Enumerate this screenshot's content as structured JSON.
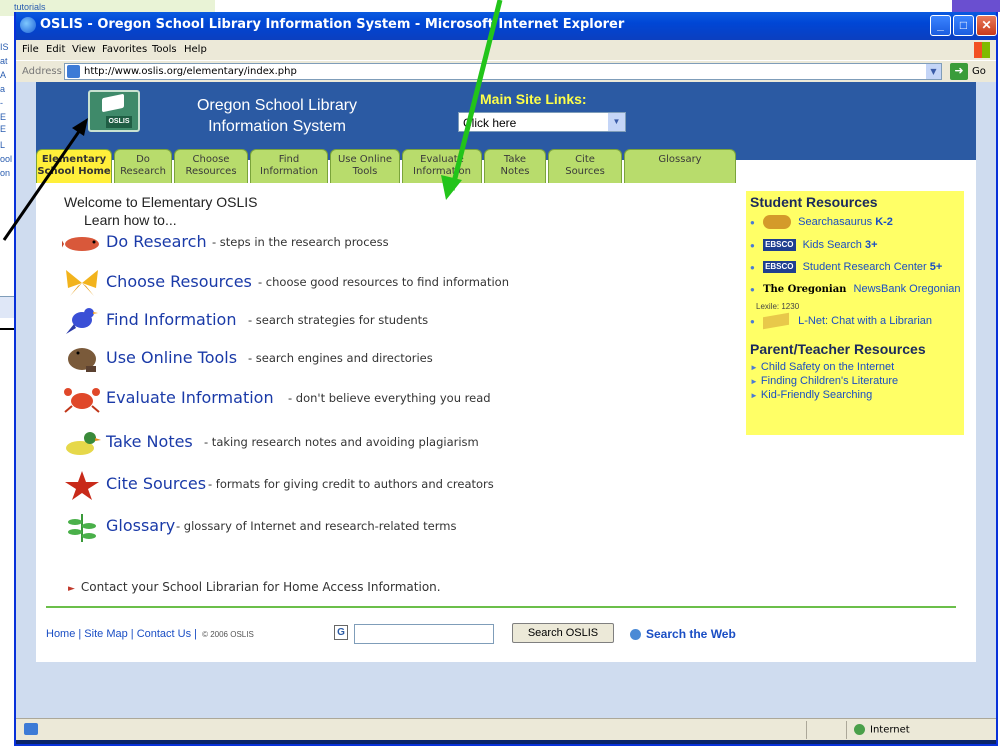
{
  "background_window": {
    "lines": [
      "tutorials",
      "IS",
      "at",
      "A",
      "a",
      "-",
      "E",
      "E",
      "L",
      "ool",
      "on"
    ]
  },
  "window": {
    "title": "OSLIS - Oregon School Library Information System - Microsoft Internet Explorer",
    "controls": {
      "minimize": "_",
      "maximize": "□",
      "close": "✕"
    }
  },
  "menu": {
    "items": [
      "File",
      "Edit",
      "View",
      "Favorites",
      "Tools",
      "Help"
    ]
  },
  "address": {
    "label": "Address",
    "url": "http://www.oslis.org/elementary/index.php",
    "go_label": "Go"
  },
  "header": {
    "logo_label": "OSLIS",
    "site_name_line1": "Oregon School Library",
    "site_name_line2": "Information System",
    "main_links_label": "Main Site Links:",
    "main_links_selected": "Click here"
  },
  "tabs": [
    {
      "line1": "Elementary",
      "line2": "School Home"
    },
    {
      "line1": "Do",
      "line2": "Research"
    },
    {
      "line1": "Choose",
      "line2": "Resources"
    },
    {
      "line1": "Find",
      "line2": "Information"
    },
    {
      "line1": "Use Online",
      "line2": "Tools"
    },
    {
      "line1": "Evaluate",
      "line2": "Information"
    },
    {
      "line1": "Take",
      "line2": "Notes"
    },
    {
      "line1": "Cite",
      "line2": "Sources"
    },
    {
      "line1": "",
      "line2": "Glossary"
    }
  ],
  "content": {
    "welcome": "Welcome to Elementary OSLIS",
    "learn_how": "Learn how to...",
    "items": [
      {
        "title": "Do Research",
        "desc": "- steps in the research process"
      },
      {
        "title": "Choose Resources",
        "desc": "- choose good resources to find information"
      },
      {
        "title": "Find Information",
        "desc": "- search strategies for students"
      },
      {
        "title": "Use Online Tools",
        "desc": "- search engines and directories"
      },
      {
        "title": "Evaluate Information",
        "desc": "- don't believe everything you read"
      },
      {
        "title": "Take Notes",
        "desc": "- taking research notes and avoiding plagiarism"
      },
      {
        "title": "Cite Sources",
        "desc": "- formats for giving credit to authors and creators"
      },
      {
        "title": "Glossary",
        "desc": "- glossary of Internet and research-related terms"
      }
    ],
    "contact": "Contact your School Librarian for Home Access Information."
  },
  "sidebar": {
    "student_heading": "Student Resources",
    "searchasaurus": "Searchasaurus",
    "searchasaurus_grade": "K-2",
    "kids_search": "Kids Search",
    "kids_search_grade": "3+",
    "src": "Student Research Center",
    "src_grade": "5+",
    "ebsco_badge": "EBSCO",
    "oregonian_logo": "The Oregonian",
    "newsbank": "NewsBank Oregonian",
    "lexile": "Lexile: 1230",
    "lnet": "L-Net: Chat with a Librarian",
    "parent_heading": "Parent/Teacher Resources",
    "parent_links": [
      "Child Safety on the Internet",
      "Finding Children's Literature",
      "Kid-Friendly Searching"
    ]
  },
  "footer": {
    "links": "Home | Site Map | Contact Us |",
    "copyright": "© 2006 OSLIS",
    "google_icon": "G",
    "search_button": "Search OSLIS",
    "search_web": "Search the Web"
  },
  "status": {
    "zone": "Internet"
  },
  "colors": {
    "header_blue": "#2b5aa3",
    "tab_green": "#b8dc6c",
    "tab_active_yellow": "#ffef3a",
    "link_blue": "#1a3aa8",
    "sidebar_yellow": "#ffff66",
    "annotation_green": "#22c41a"
  }
}
